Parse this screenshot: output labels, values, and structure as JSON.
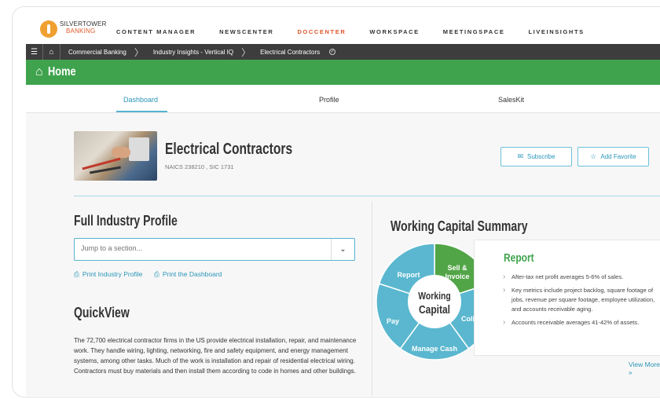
{
  "logo": {
    "line1": "SILVERTOWER",
    "line2": "BANKING"
  },
  "nav": {
    "items": [
      "CONTENT MANAGER",
      "NEWSCENTER",
      "DOCCENTER",
      "WORKSPACE",
      "MEETINGSPACE",
      "LIVEINSIGHTS"
    ],
    "active": "DOCCENTER",
    "active_color": "#e0552b"
  },
  "breadcrumb": [
    "Commercial Banking",
    "Industry Insights - Vertical IQ",
    "Electrical Contractors"
  ],
  "home": {
    "title": "Home",
    "color": "#3fa34d"
  },
  "tabs": {
    "dashboard": "Dashboard",
    "profile": "Profile",
    "saleskit": "SalesKit"
  },
  "industry": {
    "name": "Electrical Contractors",
    "codes": "NAICS 238210 , SIC 1731"
  },
  "actions": {
    "subscribe": "Subscribe",
    "favorite": "Add Favorite"
  },
  "profile": {
    "heading": "Full Industry Profile",
    "jump_placeholder": "Jump to a section...",
    "print_profile": "Print Industry Profile",
    "print_dashboard": "Print the Dashboard"
  },
  "quickview": {
    "heading": "QuickView",
    "text": "The 72,700 electrical contractor firms in the US provide electrical installation, repair, and maintenance work. They handle wiring, lighting, networking, fire and safety equipment, and energy management systems, among other tasks. Much of the work is installation and repair of residential electrical wiring. Contractors must buy materials and then install them according to code in homes and other buildings."
  },
  "working_capital": {
    "heading": "Working Capital Summary",
    "center_line1": "Working",
    "center_line2": "Capital",
    "segments": [
      {
        "label": "Report",
        "color": "#52a547"
      },
      {
        "label": "Sell & Invoice",
        "color": "#5ab7cf"
      },
      {
        "label": "Collect",
        "color": "#5ab7cf"
      },
      {
        "label": "Manage Cash",
        "color": "#5ab7cf"
      },
      {
        "label": "Pay",
        "color": "#5ab7cf"
      }
    ],
    "report": {
      "title": "Report",
      "bullets": [
        "After-tax net profit averages 5-6% of sales.",
        "Key metrics include project backlog, square footage of jobs, revenue per square footage, employee utilization, and accounts receivable aging.",
        "Accounts receivable averages 41-42% of assets."
      ],
      "view_more": "View More »"
    }
  }
}
